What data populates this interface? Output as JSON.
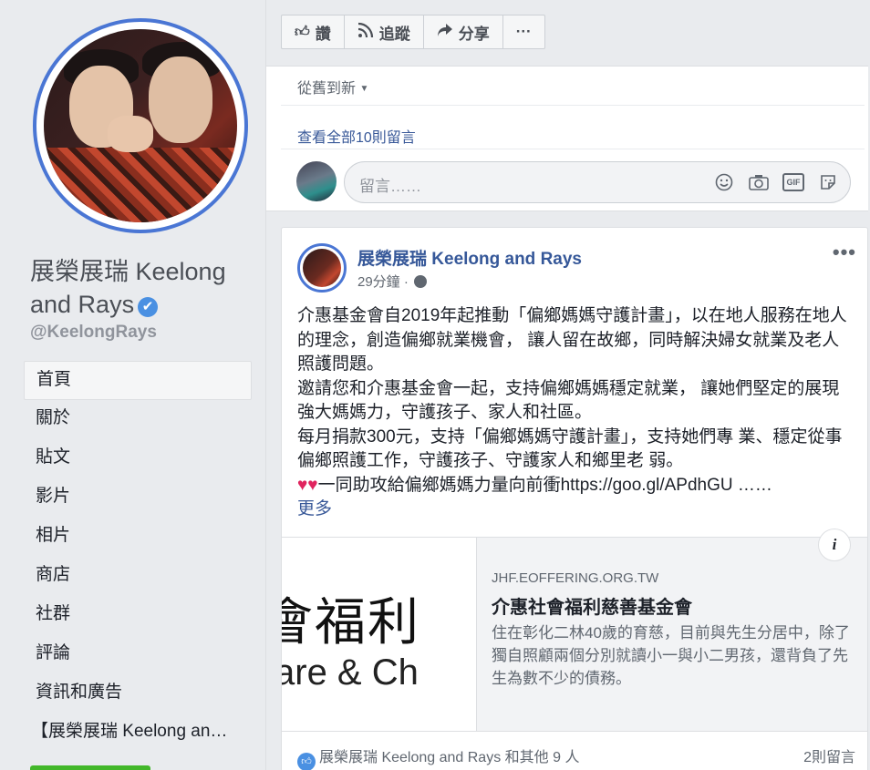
{
  "page": {
    "name": "展榮展瑞 Keelong and Rays",
    "verified_mark": "✔",
    "handle": "@KeelongRays"
  },
  "nav": {
    "items": [
      "首頁",
      "關於",
      "貼文",
      "影片",
      "相片",
      "商店",
      "社群",
      "評論",
      "資訊和廣告",
      "【展榮展瑞 Keelong an…"
    ]
  },
  "actions": {
    "like": "讚",
    "follow": "追蹤",
    "share": "分享",
    "more": "···"
  },
  "comments": {
    "sort_label": "從舊到新",
    "view_all": "查看全部10則留言",
    "input_placeholder": "留言……"
  },
  "post": {
    "author": "展榮展瑞 Keelong and Rays",
    "time": "29分鐘 ·",
    "more": "•••",
    "text_1": "介惠基金會自2019年起推動「偏鄉媽媽守護計畫」，以在地人服務在地人的理念，創造偏鄉就業機會， 讓人留在故鄉，同時解決婦女就業及老人照護問題。\n邀請您和介惠基金會一起，支持偏鄉媽媽穩定就業， 讓她們堅定的展現強大媽媽力，守護孩子、家人和社區。\n每月捐款300元，支持「偏鄉媽媽守護計畫」，支持她們專 業、穩定從事偏鄉照護工作，守護孩子、守護家人和鄉里老 弱。\n",
    "hearts": "♥♥",
    "text_2": "一同助攻給偏鄉媽媽力量向前衝https://goo.gl/APdhGU ……",
    "see_more": "更多"
  },
  "link_card": {
    "image_text_big": "會福利",
    "image_text_small": "are & Ch",
    "domain": "JHF.EOFFERING.ORG.TW",
    "title": "介惠社會福利慈善基金會",
    "description": "住在彰化二林40歲的育慈，目前與先生分居中，除了獨自照顧兩個分別就讀小一與小二男孩，還背負了先生為數不少的債務。",
    "info_glyph": "i"
  },
  "reactions": {
    "summary": "展榮展瑞 Keelong and Rays 和其他 9 人",
    "comment_count": "2則留言"
  },
  "colors": {
    "link_blue": "#385898",
    "verified_blue": "#4a90e2",
    "page_bg": "#e9ebee",
    "heart_red": "#e0245e"
  }
}
